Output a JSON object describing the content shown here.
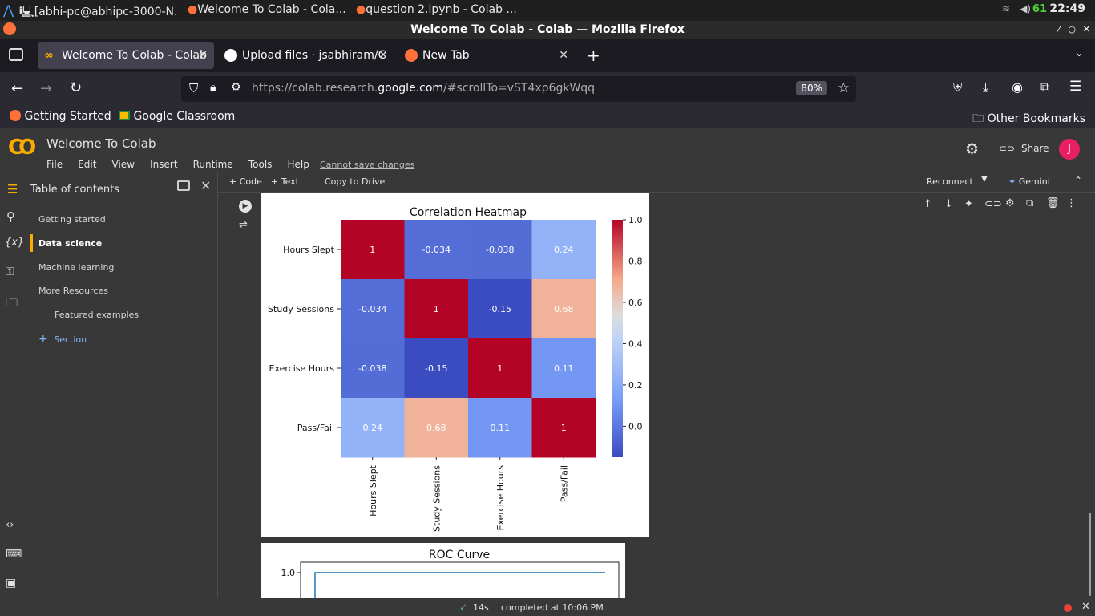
{
  "os": {
    "tasks": [
      "[abhi-pc@abhipc-3000-N...",
      "Welcome To Colab - Cola...",
      "question 2.ipynb - Colab ..."
    ],
    "battery": "61",
    "clock": "22:49"
  },
  "window": {
    "title": "Welcome To Colab - Colab — Mozilla Firefox"
  },
  "tabs": [
    {
      "label": "Welcome To Colab - Colab"
    },
    {
      "label": "Upload files · jsabhiram/C"
    },
    {
      "label": "New Tab"
    }
  ],
  "nav": {
    "url_prefix": "https://colab.research.",
    "url_domain": "google.com",
    "url_suffix": "/#scrollTo=vST4xp6gkWqq",
    "zoom": "80%"
  },
  "bookmarks": {
    "items": [
      "Getting Started",
      "Google Classroom"
    ],
    "other": "Other Bookmarks"
  },
  "colab": {
    "title": "Welcome To Colab",
    "menus": [
      "File",
      "Edit",
      "View",
      "Insert",
      "Runtime",
      "Tools",
      "Help"
    ],
    "cannot_save": "Cannot save changes",
    "share": "Share",
    "avatar": "J"
  },
  "toolbar": {
    "code": "Code",
    "text": "Text",
    "copy_to_drive": "Copy to Drive",
    "reconnect": "Reconnect",
    "gemini": "Gemini"
  },
  "toc": {
    "title": "Table of contents",
    "items": [
      "Getting started",
      "Data science",
      "Machine learning",
      "More Resources",
      "Featured examples"
    ],
    "section": "Section"
  },
  "status": {
    "duration": "14s",
    "completed": "completed at 10:06 PM"
  },
  "chart_data": [
    {
      "type": "heatmap",
      "title": "Correlation Heatmap",
      "rows": [
        "Hours Slept",
        "Study Sessions",
        "Exercise Hours",
        "Pass/Fail"
      ],
      "cols": [
        "Hours Slept",
        "Study Sessions",
        "Exercise Hours",
        "Pass/Fail"
      ],
      "values": [
        [
          1,
          -0.034,
          -0.038,
          0.24
        ],
        [
          -0.034,
          1,
          -0.15,
          0.68
        ],
        [
          -0.038,
          -0.15,
          1,
          0.11
        ],
        [
          0.24,
          0.68,
          0.11,
          1
        ]
      ],
      "labels": [
        [
          "1",
          "-0.034",
          "-0.038",
          "0.24"
        ],
        [
          "-0.034",
          "1",
          "-0.15",
          "0.68"
        ],
        [
          "-0.038",
          "-0.15",
          "1",
          "0.11"
        ],
        [
          "0.24",
          "0.68",
          "0.11",
          "1"
        ]
      ],
      "colorbar_ticks": [
        "1.0",
        "0.8",
        "0.6",
        "0.4",
        "0.2",
        "0.0"
      ],
      "colorbar_values": [
        1.0,
        0.8,
        0.6,
        0.4,
        0.2,
        0.0
      ],
      "vmin": -0.15,
      "vmax": 1.0,
      "colormap": "coolwarm"
    },
    {
      "type": "line",
      "title": "ROC Curve",
      "yticks": [
        "1.0"
      ],
      "ytick_values": [
        1.0
      ]
    }
  ]
}
